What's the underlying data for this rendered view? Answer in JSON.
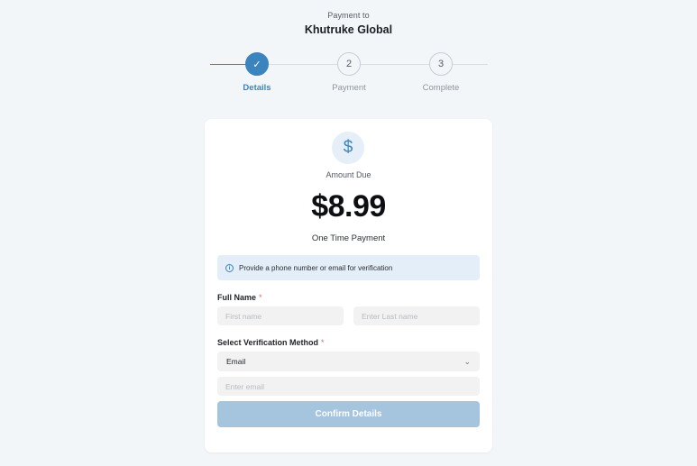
{
  "header": {
    "payment_to_label": "Payment to",
    "merchant_name": "Khutruke Global"
  },
  "steps": [
    {
      "number": "✓",
      "label": "Details",
      "active": true
    },
    {
      "number": "2",
      "label": "Payment",
      "active": false
    },
    {
      "number": "3",
      "label": "Complete",
      "active": false
    }
  ],
  "card": {
    "icon": "dollar-icon",
    "amount_label": "Amount Due",
    "amount": "$8.99",
    "payment_type": "One Time Payment",
    "info_text": "Provide a phone number or email for verification",
    "full_name_label": "Full Name",
    "required_marker": "*",
    "first_name_placeholder": "First name",
    "last_name_placeholder": "Enter Last name",
    "verification_label": "Select Verification Method",
    "verification_selected": "Email",
    "email_placeholder": "Enter email",
    "confirm_label": "Confirm Details"
  },
  "colors": {
    "accent": "#3b84bd",
    "button_disabled": "#a5c4de",
    "info_bg": "#e4eef8",
    "required": "#e06a5a"
  }
}
